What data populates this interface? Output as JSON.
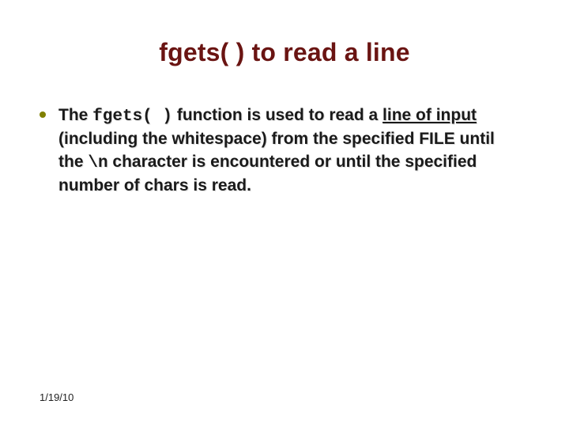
{
  "title": "fgets( ) to read a line",
  "bullet": {
    "t1": "The ",
    "code1": "fgets( )",
    "t2": " function is used to read a ",
    "underline": "line of input",
    "t3": " (including the whitespace) from the specified FILE until the ",
    "code2": "\\n",
    "t4": " character is encountered or until the specified number of chars is read."
  },
  "footer": {
    "date": "1/19/10"
  }
}
